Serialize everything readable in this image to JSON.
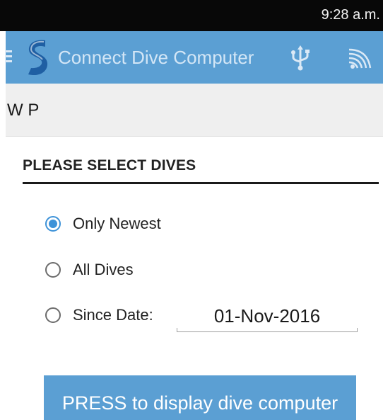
{
  "status_bar": {
    "time": "9:28 a.m."
  },
  "app_bar": {
    "title": "Connect Dive Computer",
    "icons": [
      "menu-icon",
      "scubapro-logo-icon",
      "usb-icon",
      "wireless-icon"
    ],
    "color": "#5b9fd3"
  },
  "device": {
    "name": "W P"
  },
  "dive_selection": {
    "heading": "PLEASE SELECT DIVES",
    "options": [
      {
        "label": "Only Newest",
        "selected": true
      },
      {
        "label": "All Dives",
        "selected": false
      },
      {
        "label": "Since Date:",
        "selected": false
      }
    ],
    "since_date_value": "01-Nov-2016"
  },
  "press_button": {
    "label": "PRESS to display dive computer"
  },
  "colors": {
    "accent": "#3d92d8",
    "bar": "#5b9fd3"
  }
}
